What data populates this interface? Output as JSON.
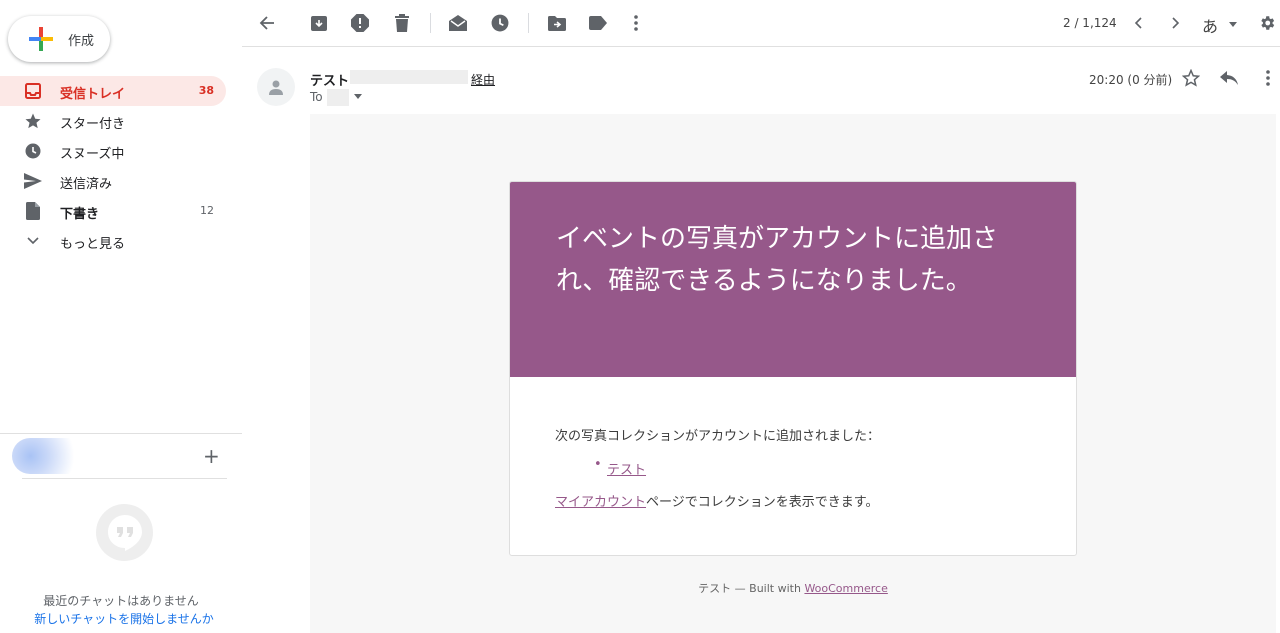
{
  "sidebar": {
    "compose_label": "作成",
    "items": [
      {
        "label": "受信トレイ",
        "count": "38"
      },
      {
        "label": "スター付き",
        "count": ""
      },
      {
        "label": "スヌーズ中",
        "count": ""
      },
      {
        "label": "送信済み",
        "count": ""
      },
      {
        "label": "下書き",
        "count": "12"
      },
      {
        "label": "もっと見る",
        "count": ""
      }
    ],
    "add_chat_symbol": "+",
    "no_chats_text": "最近のチャットはありません",
    "start_chat_link": "新しいチャットを開始しませんか"
  },
  "toolbar": {
    "icons": [
      "back-arrow-icon",
      "archive-icon",
      "report-spam-icon",
      "delete-icon",
      "mark-unread-icon",
      "snooze-icon",
      "move-to-icon",
      "label-icon",
      "more-icon"
    ],
    "pagination": "2 / 1,124",
    "input_method": "あ"
  },
  "email": {
    "sender_name": "テスト",
    "via_label": "経由",
    "to_label": "To",
    "time": "20:20 (0 分前)",
    "title": "イベントの写真がアカウントに追加され、確認できるようになりました。",
    "intro": "次の写真コレクションがアカウントに追加されました：",
    "collection_link": "テスト",
    "bullet": "•",
    "my_account_link": "マイアカウント",
    "view_suffix": "ページでコレクションを表示できます。",
    "footer_prefix": "テスト — Built with ",
    "footer_link": "WooCommerce"
  },
  "colors": {
    "accent": "#96588a",
    "inbox_active_bg": "#fce8e6",
    "inbox_active_text": "#d93025",
    "link_blue": "#1a73e8"
  }
}
